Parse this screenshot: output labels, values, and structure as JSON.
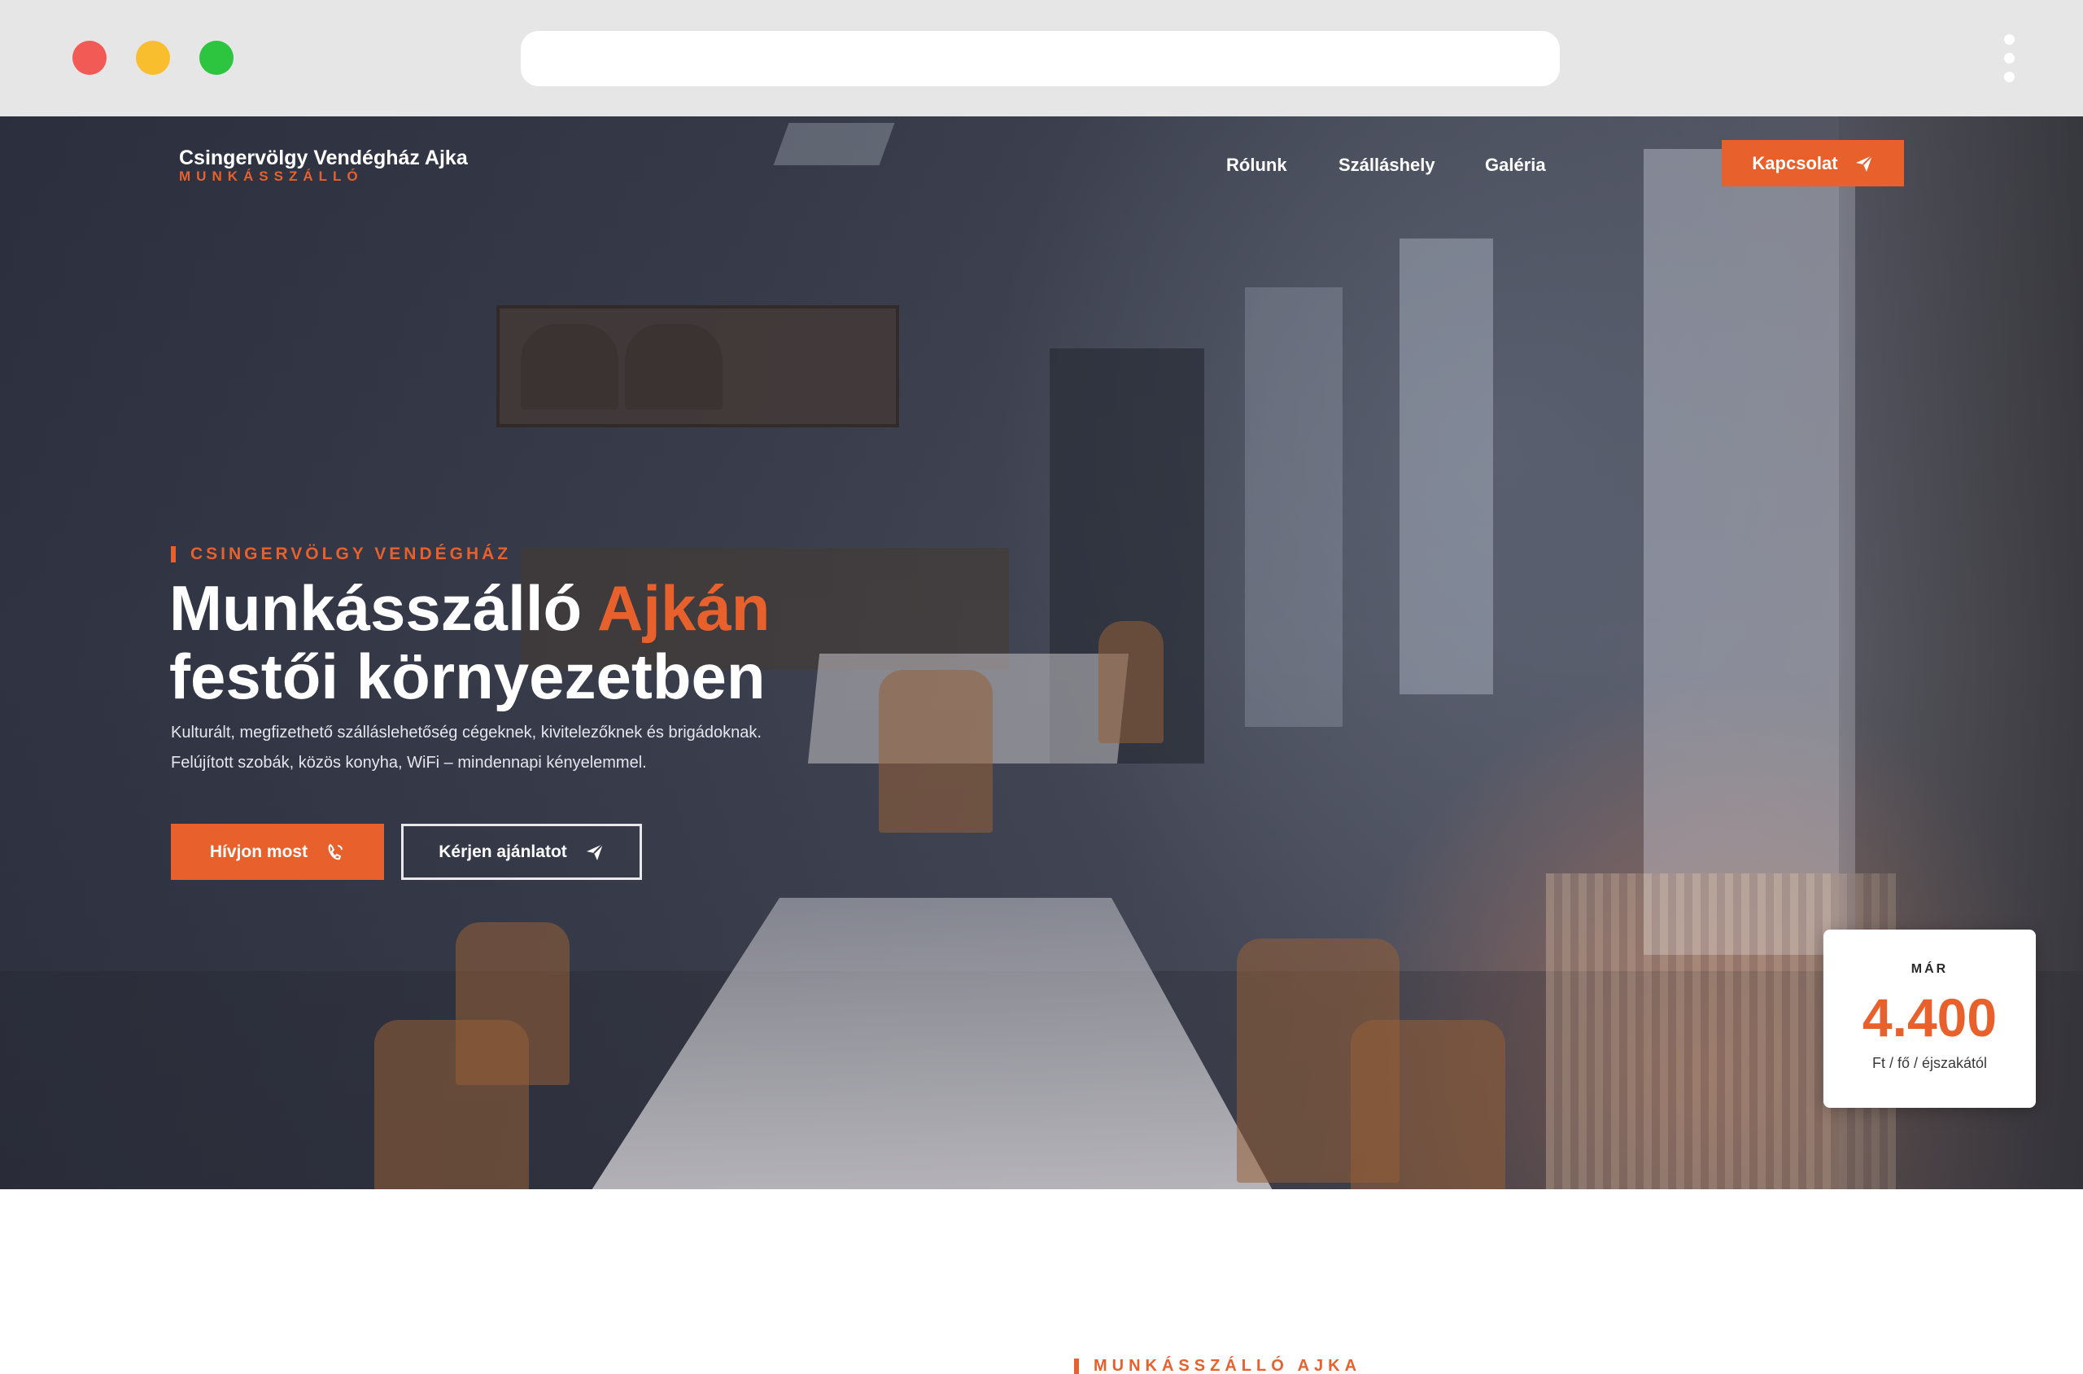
{
  "site": {
    "logo_title": "Csingervölgy Vendégház Ajka",
    "logo_subtitle": "MUNKÁSSZÁLLÓ"
  },
  "nav": {
    "items": [
      {
        "label": "Rólunk"
      },
      {
        "label": "Szálláshely"
      },
      {
        "label": "Galéria"
      }
    ],
    "cta_label": "Kapcsolat"
  },
  "hero": {
    "eyebrow": "CSINGERVÖLGY VENDÉGHÁZ",
    "title_line1_prefix": "Munkásszálló ",
    "title_line1_accent": "Ajkán",
    "title_line2": "festői környezetben",
    "description_line1": "Kulturált, megfizethető szálláslehetőség cégeknek, kivitelezőknek és brigádoknak.",
    "description_line2": "Felújított szobák, közös konyha, WiFi – mindennapi kényelemmel.",
    "primary_button": "Hívjon most",
    "secondary_button": "Kérjen ajánlatot"
  },
  "price_card": {
    "label": "MÁR",
    "value": "4.400",
    "unit": "Ft / fő / éjszakától"
  },
  "next_section": {
    "eyebrow": "MUNKÁSSZÁLLÓ AJKA"
  },
  "colors": {
    "accent": "#e8602c",
    "chrome": "#e6e6e6"
  },
  "icons": {
    "send": "paper-plane-icon",
    "phone": "phone-icon"
  }
}
